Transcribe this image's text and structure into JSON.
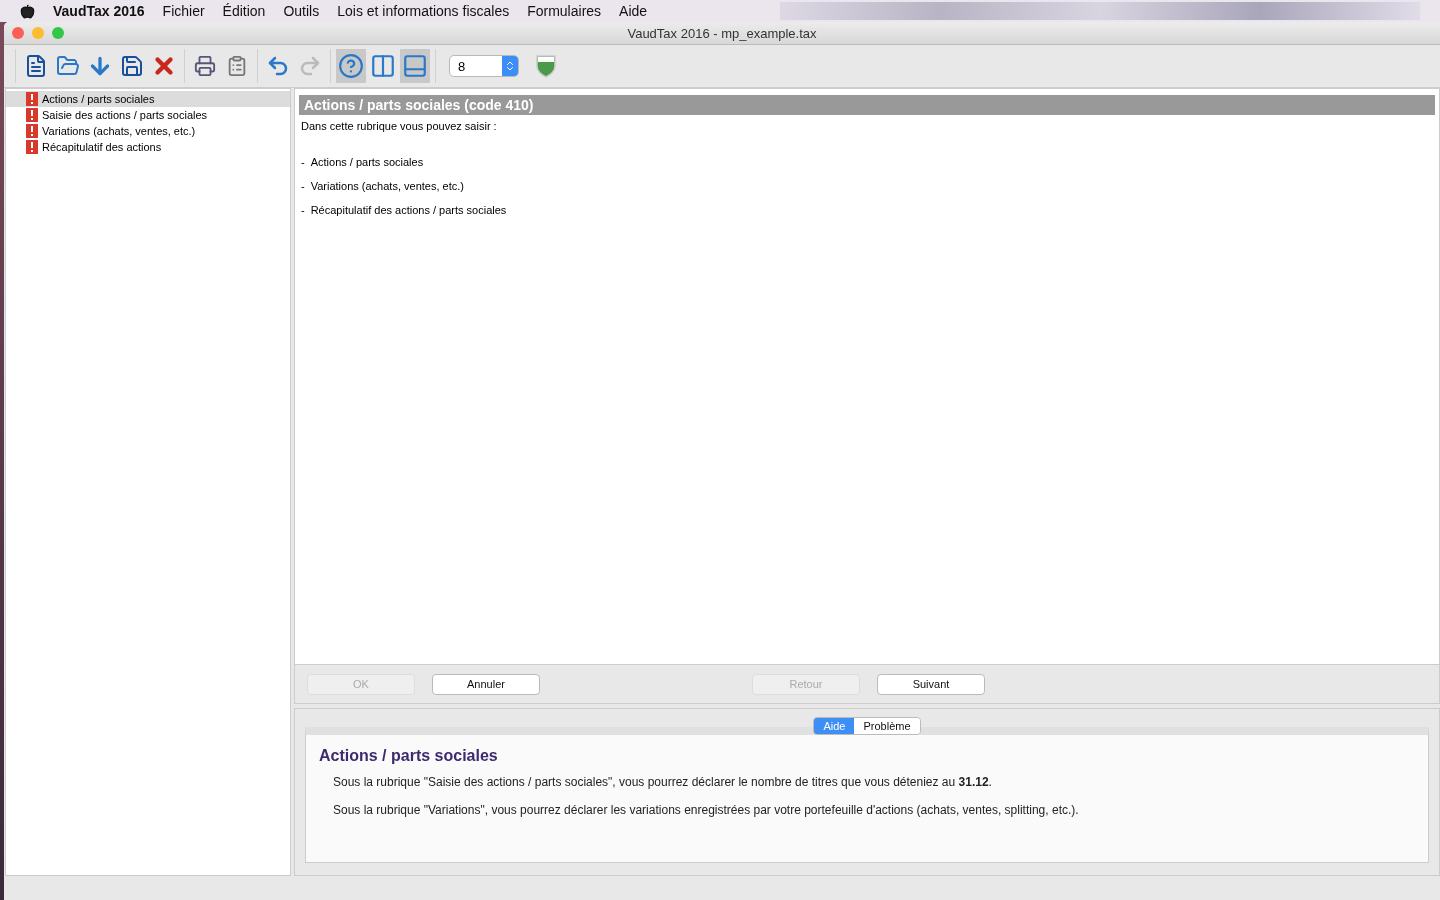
{
  "menu_bar": {
    "app": "VaudTax 2016",
    "items": [
      "Fichier",
      "Édition",
      "Outils",
      "Lois et informations fiscales",
      "Formulaires",
      "Aide"
    ]
  },
  "window": {
    "title": "VaudTax 2016 - mp_example.tax"
  },
  "toolbar": {
    "toggles": [
      {
        "kind": "help",
        "pressed": true
      },
      {
        "kind": "columns",
        "pressed": false
      },
      {
        "kind": "panel",
        "pressed": true
      }
    ],
    "zoom_select": "8"
  },
  "sidebar": {
    "items": [
      {
        "label": "Actions / parts sociales",
        "selected": true,
        "warning": true
      },
      {
        "label": "Saisie des actions / parts sociales",
        "selected": false,
        "warning": true
      },
      {
        "label": "Variations (achats, ventes, etc.)",
        "selected": false,
        "warning": true
      },
      {
        "label": "Récapitulatif des actions",
        "selected": false,
        "warning": true
      }
    ]
  },
  "content": {
    "heading": "Actions / parts sociales (code 410)",
    "intro": "Dans cette rubrique vous pouvez saisir :",
    "items": [
      {
        "bullet": "-",
        "text": "Actions / parts sociales"
      },
      {
        "bullet": "-",
        "text": "Variations (achats, ventes, etc.)"
      },
      {
        "bullet": "-",
        "text": "Récapitulatif des actions / parts sociales"
      }
    ]
  },
  "buttons": [
    {
      "label": "OK",
      "disabled": true
    },
    {
      "label": "Annuler",
      "disabled": false
    },
    {
      "label": "Retour",
      "disabled": true
    },
    {
      "label": "Suivant",
      "disabled": false
    }
  ],
  "help": {
    "tabs": [
      {
        "label": "Aide",
        "selected": true
      },
      {
        "label": "Problème",
        "selected": false
      }
    ],
    "title": "Actions / parts sociales",
    "paragraphs": [
      "Sous la rubrique \"Saisie des actions / parts sociales\", vous pourrez déclarer le nombre de titres que vous déteniez au **31.12**.",
      "Sous la rubrique \"Variations\", vous pourrez déclarer les variations enregistrées par votre portefeuille d'actions (achats, ventes, splitting, etc.)."
    ]
  }
}
